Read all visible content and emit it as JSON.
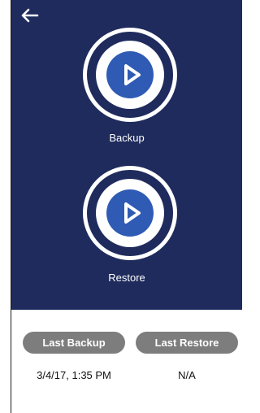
{
  "nav": {
    "back_icon": "arrow-left-icon"
  },
  "actions": [
    {
      "label": "Backup",
      "icon": "play-icon"
    },
    {
      "label": "Restore",
      "icon": "play-icon"
    }
  ],
  "history": {
    "last_backup_label": "Last Backup",
    "last_restore_label": "Last Restore",
    "last_backup_value": "3/4/17, 1:35 PM",
    "last_restore_value": "N/A"
  },
  "colors": {
    "hero_bg": "#1e2b5c",
    "play_blue": "#2f5bb5",
    "pill_gray": "#7d7d7d"
  }
}
